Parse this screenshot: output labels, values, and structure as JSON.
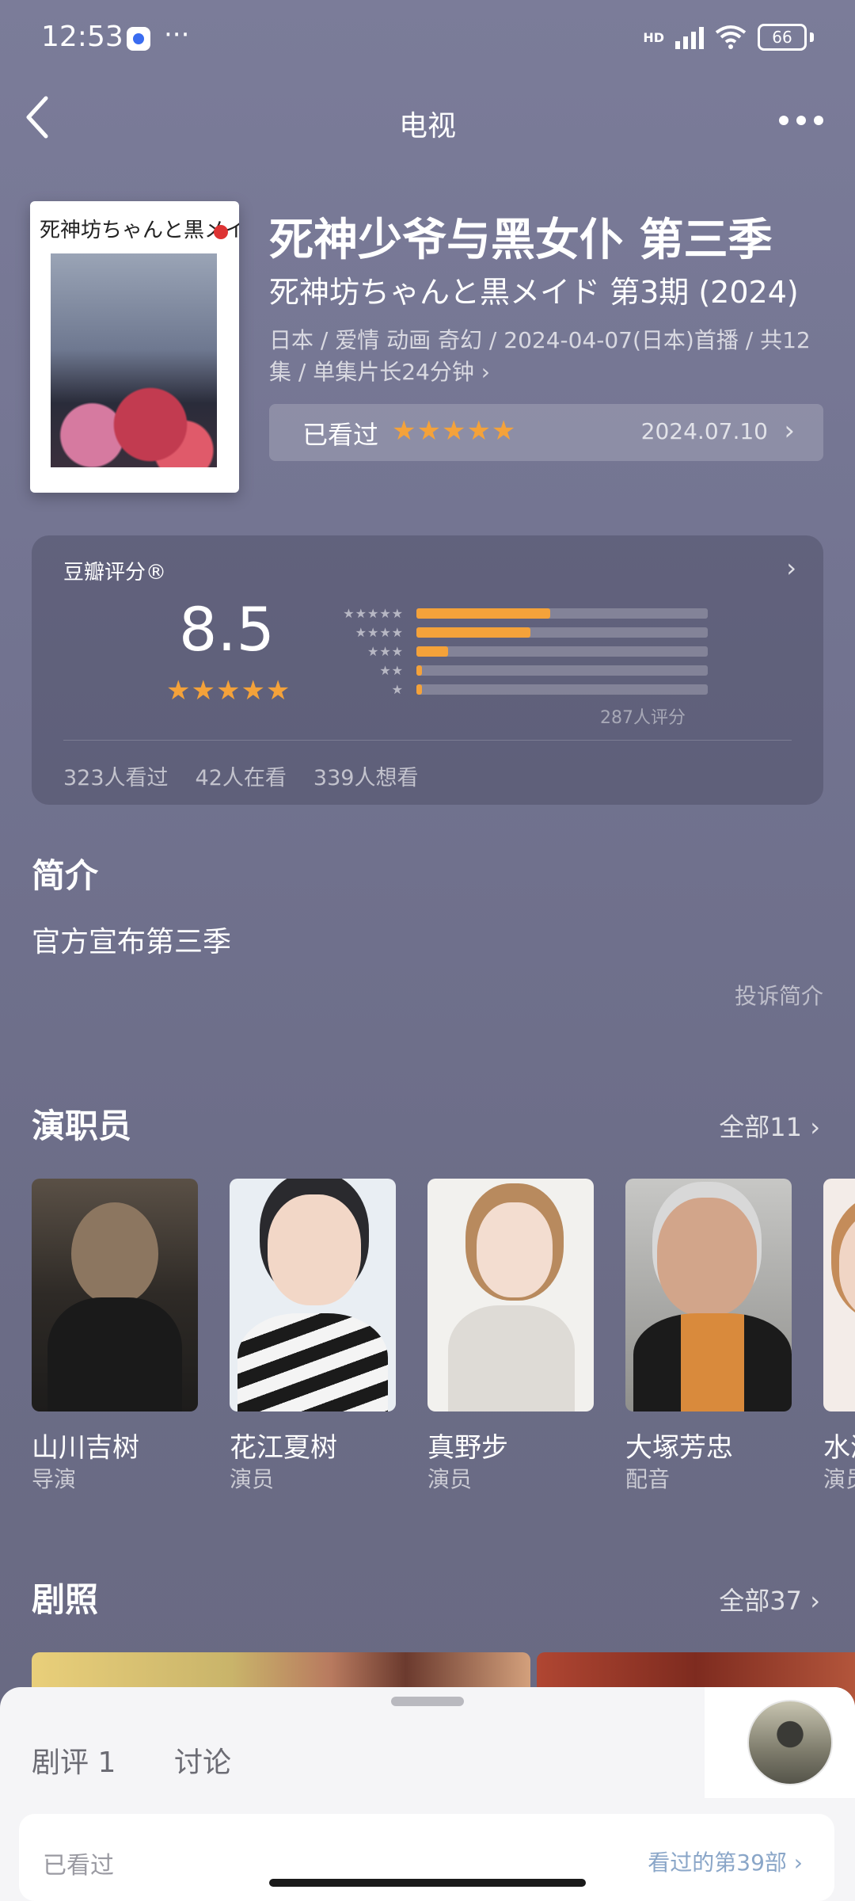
{
  "status": {
    "time": "12:53",
    "battery": "66",
    "network": "HD",
    "more": "···"
  },
  "nav": {
    "title": "电视"
  },
  "poster": {
    "title": "死神坊ちゃんと黒メイド"
  },
  "show": {
    "title": "死神少爷与黑女仆 第三季",
    "subtitle": "死神坊ちゃんと黒メイド 第3期 (2024)",
    "meta": "日本 / 爱情 动画 奇幻 / 2024-04-07(日本)首播 / 共12集 / 单集片长24分钟 ›"
  },
  "watched": {
    "label": "已看过",
    "stars": "★★★★★",
    "date": "2024.07.10",
    "rating": 5
  },
  "rating": {
    "label": "豆瓣评分®",
    "score": "8.5",
    "stars": "★★★★★",
    "distribution": [
      {
        "stars": "★★★★★",
        "fraction": 0.46
      },
      {
        "stars": "★★★★",
        "fraction": 0.39
      },
      {
        "stars": "★★★",
        "fraction": 0.11
      },
      {
        "stars": "★★",
        "fraction": 0.02
      },
      {
        "stars": "★",
        "fraction": 0.02
      }
    ],
    "count": "287人评分",
    "stats": [
      "323人看过",
      "42人在看",
      "339人想看"
    ]
  },
  "intro": {
    "heading": "简介",
    "text": "官方宣布第三季",
    "complain": "投诉简介"
  },
  "cast": {
    "heading": "演职员",
    "all": "全部11 ›",
    "members": [
      {
        "name": "山川吉树",
        "role": "导演"
      },
      {
        "name": "花江夏树",
        "role": "演员"
      },
      {
        "name": "真野步",
        "role": "演员"
      },
      {
        "name": "大塚芳忠",
        "role": "配音"
      },
      {
        "name": "水濑",
        "role": "演员"
      }
    ]
  },
  "stills": {
    "heading": "剧照",
    "all": "全部37 ›"
  },
  "sheet": {
    "tabs": [
      "剧评 1",
      "讨论"
    ],
    "card_label": "已看过",
    "card_right": "看过的第39部 ›"
  },
  "colors": {
    "accent": "#f4a23a",
    "background": "#727390"
  }
}
